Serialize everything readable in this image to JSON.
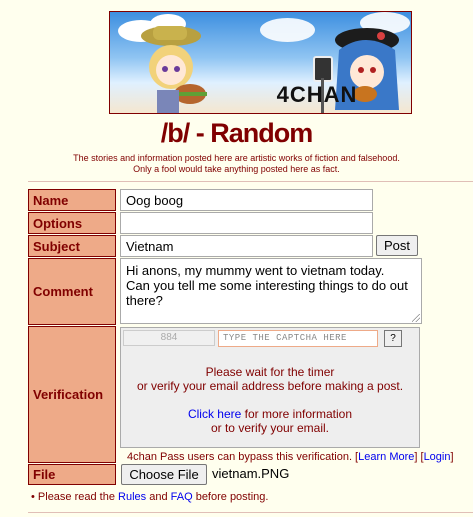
{
  "banner": {
    "logo_text": "4CHAN"
  },
  "board": {
    "title": "/b/ - Random",
    "subtitle_1": "The stories and information posted here are artistic works of fiction and falsehood.",
    "subtitle_2": "Only a fool would take anything posted here as fact."
  },
  "form": {
    "name_label": "Name",
    "name_value": "Oog boog",
    "options_label": "Options",
    "options_value": "",
    "subject_label": "Subject",
    "subject_value": "Vietnam",
    "post_button": "Post",
    "comment_label": "Comment",
    "comment_line_1": "Hi anons, my mummy went to vietnam today.",
    "comment_line_2": "Can you tell me some interesting things to do out",
    "comment_line_3": "there?",
    "verification_label": "Verification",
    "captcha_number": "884",
    "captcha_placeholder": "TYPE THE CAPTCHA HERE",
    "captcha_help": "?",
    "wait_line_1": "Please wait for the timer",
    "wait_line_2": "or verify your email address before making a post.",
    "click_here": "Click here",
    "more_info": " for more information",
    "verify_email": "or to verify your email.",
    "pass_text": "4chan Pass users can bypass this verification. [",
    "learn_more": "Learn More",
    "pass_sep": "] [",
    "login": "Login",
    "pass_end": "]",
    "file_label": "File",
    "choose_file": "Choose File",
    "file_name": "vietnam.PNG",
    "rules_prefix": "• Please read the ",
    "rules_link": "Rules",
    "rules_and": " and ",
    "faq_link": "FAQ",
    "rules_suffix": " before posting."
  }
}
